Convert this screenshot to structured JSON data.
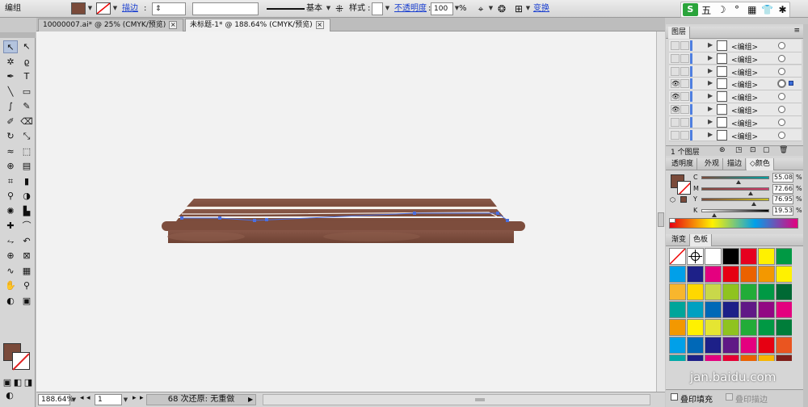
{
  "control_bar": {
    "mode_label": "编组",
    "stroke_label": "描边",
    "stroke_profile_label": "基本",
    "style_label": "样式",
    "opacity_label": "不透明度",
    "opacity_value": "100",
    "opacity_unit": "%",
    "transform_label": "变换",
    "fill_color": "#7a4a3a",
    "stroke_color": "none",
    "icons": [
      "chevron-down-icon",
      "no-stroke-icon",
      "align-icon",
      "recolor-icon",
      "transform-icon"
    ]
  },
  "ime": {
    "logo": "S",
    "items": [
      "五",
      "☽",
      "°",
      "▦",
      "👕",
      "✱"
    ]
  },
  "tabs": [
    {
      "label": "10000007.ai* @ 25% (CMYK/预览)",
      "active": false
    },
    {
      "label": "未标题-1* @ 188.64% (CMYK/预览)",
      "active": true
    }
  ],
  "tools": [
    {
      "name": "selection-tool",
      "glyph": "↖"
    },
    {
      "name": "direct-selection-tool",
      "glyph": "↖"
    },
    {
      "name": "magic-wand-tool",
      "glyph": "✲"
    },
    {
      "name": "lasso-tool",
      "glyph": "ϱ"
    },
    {
      "name": "pen-tool",
      "glyph": "✒"
    },
    {
      "name": "type-tool",
      "glyph": "T"
    },
    {
      "name": "line-tool",
      "glyph": "╲"
    },
    {
      "name": "rectangle-tool",
      "glyph": "▭"
    },
    {
      "name": "paintbrush-tool",
      "glyph": "∫"
    },
    {
      "name": "pencil-tool",
      "glyph": "✎"
    },
    {
      "name": "blob-brush-tool",
      "glyph": "✐"
    },
    {
      "name": "eraser-tool",
      "glyph": "⌫"
    },
    {
      "name": "rotate-tool",
      "glyph": "↻"
    },
    {
      "name": "scale-tool",
      "glyph": "⤡"
    },
    {
      "name": "warp-tool",
      "glyph": "≈"
    },
    {
      "name": "free-transform-tool",
      "glyph": "⬚"
    },
    {
      "name": "shape-builder-tool",
      "glyph": "⊕"
    },
    {
      "name": "perspective-grid-tool",
      "glyph": "▤"
    },
    {
      "name": "mesh-tool",
      "glyph": "⌗"
    },
    {
      "name": "gradient-tool",
      "glyph": "▮"
    },
    {
      "name": "eyedropper-tool",
      "glyph": "⚲"
    },
    {
      "name": "blend-tool",
      "glyph": "◑"
    },
    {
      "name": "symbol-sprayer-tool",
      "glyph": "✺"
    },
    {
      "name": "column-graph-tool",
      "glyph": "▙"
    },
    {
      "name": "anchor-add-tool",
      "glyph": "✚"
    },
    {
      "name": "anchor-convert-tool",
      "glyph": "⌒"
    },
    {
      "name": "width-tool",
      "glyph": "⥊"
    },
    {
      "name": "reshape-tool",
      "glyph": "↶"
    },
    {
      "name": "target-tool",
      "glyph": "⊕"
    },
    {
      "name": "slice-tool",
      "glyph": "⊠"
    },
    {
      "name": "knife-tool",
      "glyph": "∿"
    },
    {
      "name": "artboard-tool",
      "glyph": "▦"
    },
    {
      "name": "hand-tool",
      "glyph": "✋"
    },
    {
      "name": "zoom-tool",
      "glyph": "⚲"
    },
    {
      "name": "transparency-mask-tool",
      "glyph": "◐"
    },
    {
      "name": "screen-mode-tool",
      "glyph": "▣"
    }
  ],
  "tool_colors": {
    "fill": "#7a4a3a",
    "stroke": "none"
  },
  "status": {
    "zoom": "188.64%",
    "artboard": "1",
    "history_text": "68 次还原: 无重做"
  },
  "layers_panel": {
    "title": "图层",
    "footer": "1 个图层",
    "items": [
      {
        "name": "<编组>",
        "visible": false
      },
      {
        "name": "<编组>",
        "visible": false
      },
      {
        "name": "<编组>",
        "visible": false
      },
      {
        "name": "<编组>",
        "visible": true,
        "selected": true
      },
      {
        "name": "<编组>",
        "visible": true
      },
      {
        "name": "<编组>",
        "visible": true
      },
      {
        "name": "<编组>",
        "visible": false
      },
      {
        "name": "<编组>",
        "visible": false
      }
    ]
  },
  "color_panel": {
    "tabs": [
      "透明度",
      "外观",
      "描边",
      "颜色"
    ],
    "active_tab": "颜色",
    "channels": [
      {
        "label": "C",
        "value": "55.08"
      },
      {
        "label": "M",
        "value": "72.66"
      },
      {
        "label": "Y",
        "value": "76.95"
      },
      {
        "label": "K",
        "value": "19.53"
      }
    ],
    "unit": "%"
  },
  "swatches_panel": {
    "tabs": [
      "渐变",
      "色板"
    ],
    "active_tab": "色板",
    "colors": [
      "none",
      "registration",
      "#ffffff",
      "#000000",
      "#e6001f",
      "#fff100",
      "#009944",
      "#00a0e9",
      "#1d2088",
      "#e4007f",
      "#e60012",
      "#eb6100",
      "#f39800",
      "#fff100",
      "#f8b62d",
      "#ffd800",
      "#c9d84a",
      "#8fc31f",
      "#22ac38",
      "#009944",
      "#006934",
      "#00a59a",
      "#00a0c1",
      "#0068b7",
      "#1d2088",
      "#601986",
      "#920783",
      "#e4007f",
      "#f39800",
      "#fff100",
      "#e5e532",
      "#8fc31f",
      "#22ac38",
      "#009944",
      "#007d3a",
      "#00a0e9",
      "#0068b7",
      "#1d2088",
      "#601986",
      "#e4007f",
      "#e60012",
      "#ea5520",
      "#00a9a8",
      "#1d2088",
      "#e4007f",
      "#e60033",
      "#eb6100",
      "#f8b500",
      "#7f1f1a"
    ],
    "bottom_options": [
      "叠印填充",
      "叠印描边"
    ]
  },
  "watermark": "jan.baidu.com"
}
